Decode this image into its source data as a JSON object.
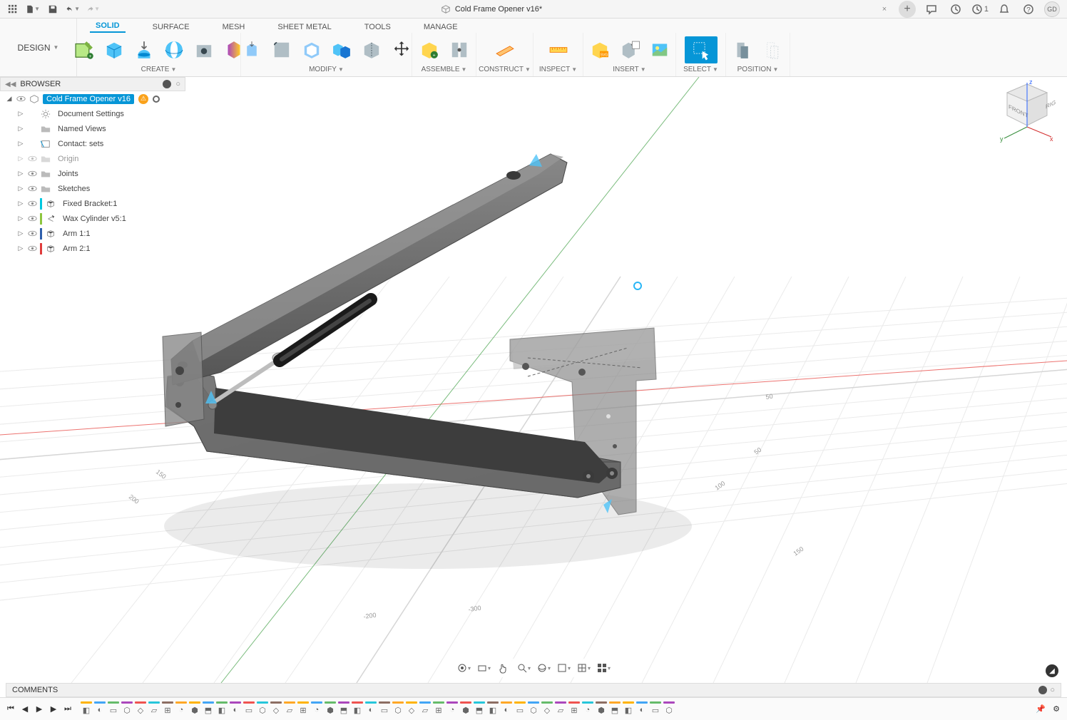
{
  "title": "Cold Frame Opener v16*",
  "user_initials": "GD",
  "job_count": "1",
  "design_label": "DESIGN",
  "ribbon_tabs": [
    "SOLID",
    "SURFACE",
    "MESH",
    "SHEET METAL",
    "TOOLS",
    "MANAGE"
  ],
  "ribbon_groups": {
    "create": "CREATE",
    "modify": "MODIFY",
    "assemble": "ASSEMBLE",
    "construct": "CONSTRUCT",
    "inspect": "INSPECT",
    "insert": "INSERT",
    "select": "SELECT",
    "position": "POSITION"
  },
  "browser_label": "BROWSER",
  "tree": {
    "root": "Cold Frame Opener v16",
    "items": [
      {
        "label": "Document Settings",
        "icon": "gear"
      },
      {
        "label": "Named Views",
        "icon": "folder"
      },
      {
        "label": "Contact: sets",
        "icon": "contact"
      },
      {
        "label": "Origin",
        "icon": "folder",
        "muted": true
      },
      {
        "label": "Joints",
        "icon": "folder"
      },
      {
        "label": "Sketches",
        "icon": "folder"
      },
      {
        "label": "Fixed Bracket:1",
        "icon": "component",
        "stripe": "#00c8e0"
      },
      {
        "label": "Wax Cylinder v5:1",
        "icon": "link",
        "stripe": "#8dc63f"
      },
      {
        "label": "Arm 1:1",
        "icon": "component",
        "stripe": "#2e5fac"
      },
      {
        "label": "Arm 2:1",
        "icon": "component",
        "stripe": "#e03c3c"
      }
    ]
  },
  "viewcube": {
    "front": "FRONT",
    "right": "RIGHT",
    "axes": {
      "x": "x",
      "y": "y",
      "z": "z"
    }
  },
  "comments_label": "COMMENTS",
  "timeline_features_count": 44
}
